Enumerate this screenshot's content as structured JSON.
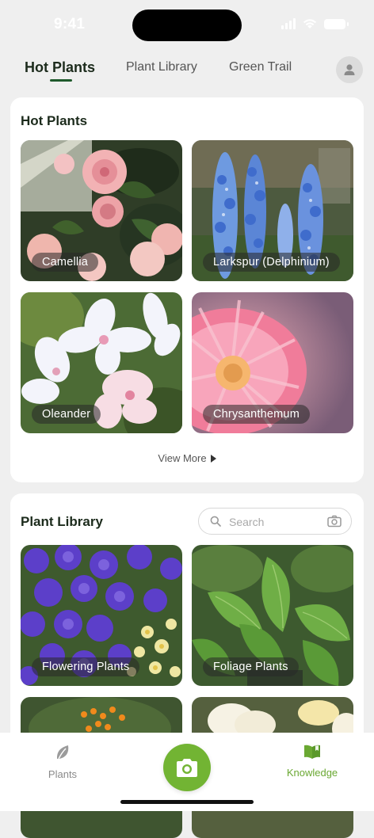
{
  "status": {
    "time": "9:41"
  },
  "tabs": [
    {
      "label": "Hot Plants",
      "active": true
    },
    {
      "label": "Plant Library",
      "active": false
    },
    {
      "label": "Green Trail",
      "active": false
    }
  ],
  "hot_plants": {
    "title": "Hot Plants",
    "items": [
      {
        "label": "Camellia"
      },
      {
        "label": "Larkspur (Delphinium)"
      },
      {
        "label": "Oleander"
      },
      {
        "label": "Chrysanthemum"
      }
    ],
    "view_more": "View More"
  },
  "library": {
    "title": "Plant Library",
    "search_placeholder": "Search",
    "items": [
      {
        "label": "Flowering Plants"
      },
      {
        "label": "Foliage Plants"
      }
    ]
  },
  "bottom_nav": {
    "plants": "Plants",
    "knowledge": "Knowledge"
  },
  "colors": {
    "accent_green": "#72b433",
    "dark_green": "#1f5a2c",
    "knowledge_green": "#6aa832"
  },
  "icons": [
    "user-icon",
    "search-icon",
    "camera-icon",
    "leaf-icon",
    "book-icon",
    "play-triangle-icon"
  ]
}
